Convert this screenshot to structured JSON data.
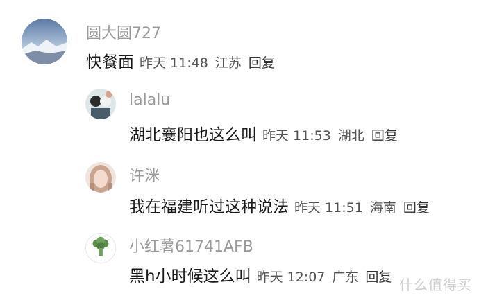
{
  "comments": [
    {
      "username": "圆大圆727",
      "content": "快餐面",
      "time": "昨天 11:48",
      "location": "江苏",
      "reply": "回复"
    },
    {
      "username": "lalalu",
      "content": "湖北襄阳也这么叫",
      "time": "昨天 11:53",
      "location": "湖北",
      "reply": "回复"
    },
    {
      "username": "许洣",
      "content": "我在福建听过这种说法",
      "time": "昨天 11:51",
      "location": "海南",
      "reply": "回复"
    },
    {
      "username": "小红薯61741AFB",
      "content": "黑h小时候这么叫",
      "time": "昨天 12:07",
      "location": "广东",
      "reply": "回复"
    }
  ],
  "watermark": "什么值得买"
}
